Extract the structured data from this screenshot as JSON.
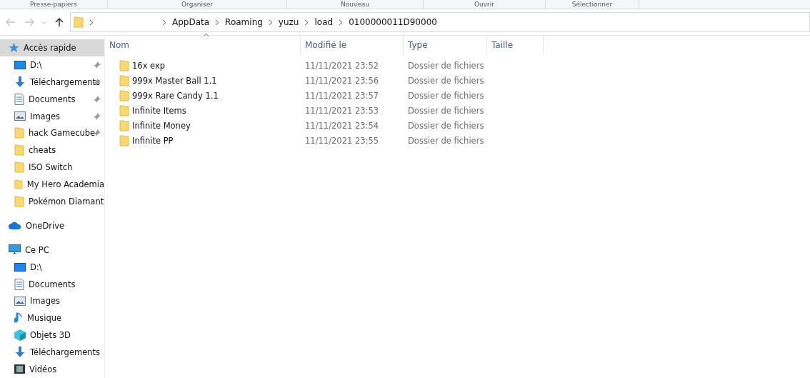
{
  "ribbon_groups": [
    "Presse-papiers",
    "Organiser",
    "Nouveau",
    "Ouvrir",
    "Sélectionner"
  ],
  "address_bar": {
    "path": [
      "AppData",
      "Roaming",
      "yuzu",
      "load",
      "0100000011D90000"
    ]
  },
  "sidebar": {
    "sections": [
      {
        "label": "Accès rapide",
        "kind": "star",
        "selected": true,
        "children": [
          {
            "label": "D:\\",
            "kind": "drive",
            "pinned": true
          },
          {
            "label": "Téléchargements",
            "kind": "download",
            "pinned": true
          },
          {
            "label": "Documents",
            "kind": "documents",
            "pinned": true
          },
          {
            "label": "Images",
            "kind": "images",
            "pinned": true
          },
          {
            "label": "hack Gamecube",
            "kind": "folder",
            "pinned": true
          },
          {
            "label": "cheats",
            "kind": "folder",
            "pinned": false
          },
          {
            "label": "ISO Switch",
            "kind": "folder",
            "pinned": false
          },
          {
            "label": "My Hero Academia",
            "kind": "folder",
            "pinned": false
          },
          {
            "label": "Pokémon Diamant",
            "kind": "folder",
            "pinned": false
          }
        ]
      },
      {
        "label": "OneDrive",
        "kind": "cloud",
        "selected": false
      },
      {
        "label": "Ce PC",
        "kind": "pc",
        "selected": false,
        "children": [
          {
            "label": "D:\\",
            "kind": "drive",
            "pinned": false
          },
          {
            "label": "Documents",
            "kind": "documents",
            "pinned": false
          },
          {
            "label": "Images",
            "kind": "images",
            "pinned": false
          },
          {
            "label": "Musique",
            "kind": "music",
            "pinned": false
          },
          {
            "label": "Objets 3D",
            "kind": "objects3d",
            "pinned": false
          },
          {
            "label": "Téléchargements",
            "kind": "download",
            "pinned": false
          },
          {
            "label": "Vidéos",
            "kind": "videos",
            "pinned": false
          }
        ]
      }
    ]
  },
  "table": {
    "columns": [
      {
        "label": "Nom",
        "sorted": true
      },
      {
        "label": "Modifié le",
        "sorted": false
      },
      {
        "label": "Type",
        "sorted": false
      },
      {
        "label": "Taille",
        "sorted": false
      }
    ],
    "rows": [
      {
        "name": "16x exp",
        "modified": "11/11/2021 23:52",
        "type": "Dossier de fichiers"
      },
      {
        "name": "999x Master Ball 1.1",
        "modified": "11/11/2021 23:56",
        "type": "Dossier de fichiers"
      },
      {
        "name": "999x Rare Candy 1.1",
        "modified": "11/11/2021 23:57",
        "type": "Dossier de fichiers"
      },
      {
        "name": "Infinite Items",
        "modified": "11/11/2021 23:53",
        "type": "Dossier de fichiers"
      },
      {
        "name": "Infinite Money",
        "modified": "11/11/2021 23:54",
        "type": "Dossier de fichiers"
      },
      {
        "name": "Infinite PP",
        "modified": "11/11/2021 23:55",
        "type": "Dossier de fichiers"
      }
    ]
  }
}
